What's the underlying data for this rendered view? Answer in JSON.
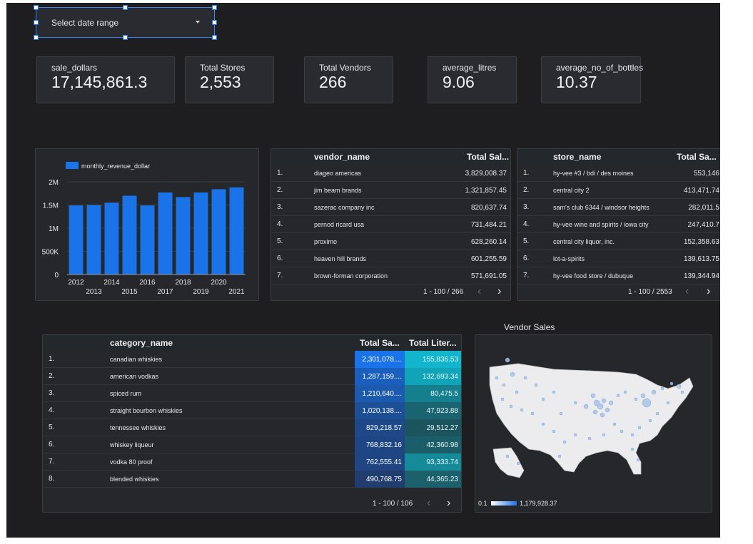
{
  "date_range": {
    "label": "Select date range"
  },
  "scorecards": [
    {
      "label": "sale_dollars",
      "value": "17,145,861.3"
    },
    {
      "label": "Total Stores",
      "value": "2,553"
    },
    {
      "label": "Total Vendors",
      "value": "266"
    },
    {
      "label": "average_litres",
      "value": "9.06"
    },
    {
      "label": "average_no_of_bottles",
      "value": "10.37"
    }
  ],
  "chart_data": {
    "type": "bar",
    "legend": "monthly_revenue_dollar",
    "categories": [
      "2012",
      "2013",
      "2014",
      "2015",
      "2016",
      "2017",
      "2018",
      "2019",
      "2020",
      "2021"
    ],
    "values": [
      1490000,
      1500000,
      1550000,
      1700000,
      1490000,
      1770000,
      1670000,
      1770000,
      1840000,
      1880000
    ],
    "ylim": [
      0,
      2000000
    ],
    "yticks": [
      "0",
      "500K",
      "1M",
      "1.5M",
      "2M"
    ],
    "bar_color": "#1a73e8"
  },
  "vendor_table": {
    "col_name": "vendor_name",
    "col_value": "Total Sal...",
    "rows": [
      {
        "idx": "1.",
        "name": "diageo americas",
        "value": "3,829,008.37"
      },
      {
        "idx": "2.",
        "name": "jim beam brands",
        "value": "1,321,857.45"
      },
      {
        "idx": "3.",
        "name": "sazerac company inc",
        "value": "820,637.74"
      },
      {
        "idx": "4.",
        "name": "pernod ricard usa",
        "value": "731,484.21"
      },
      {
        "idx": "5.",
        "name": "proximo",
        "value": "628,260.14"
      },
      {
        "idx": "6.",
        "name": "heaven hill brands",
        "value": "601,255.59"
      },
      {
        "idx": "7.",
        "name": "brown-forman corporation",
        "value": "571,691.05"
      }
    ],
    "pager": "1 - 100 / 266"
  },
  "store_table": {
    "col_name": "store_name",
    "col_value": "Total Sa...",
    "rows": [
      {
        "idx": "1.",
        "name": "hy-vee #3 / bdi / des moines",
        "value": "553,146"
      },
      {
        "idx": "2.",
        "name": "central city 2",
        "value": "413,471.74"
      },
      {
        "idx": "3.",
        "name": "sam's club 6344 / windsor heights",
        "value": "282,011.5"
      },
      {
        "idx": "4.",
        "name": "hy-vee wine and spirits / iowa city",
        "value": "247,410.7"
      },
      {
        "idx": "5.",
        "name": "central city liquor, inc.",
        "value": "152,358.63"
      },
      {
        "idx": "6.",
        "name": "lot-a-spirits",
        "value": "139,613.75"
      },
      {
        "idx": "7.",
        "name": "hy-vee food store / dubuque",
        "value": "139,344.94"
      }
    ],
    "pager": "1 - 100 / 2553"
  },
  "category_table": {
    "col_name": "category_name",
    "col_sales": "Total Sa...",
    "col_liters": "Total Liter...",
    "rows": [
      {
        "idx": "1.",
        "name": "canadian whiskies",
        "sales": "2,301,078....",
        "liters": "155,836.53",
        "sales_color": "#1a73e8",
        "liters_color": "#12b5cb"
      },
      {
        "idx": "2.",
        "name": "american vodkas",
        "sales": "1,287,159....",
        "liters": "132,693.34",
        "sales_color": "#1a5fbd",
        "liters_color": "#11a4b8"
      },
      {
        "idx": "3.",
        "name": "spiced rum",
        "sales": "1,210,640....",
        "liters": "80,475.5",
        "sales_color": "#1c5aaf",
        "liters_color": "#167f8d"
      },
      {
        "idx": "4.",
        "name": "straight bourbon whiskies",
        "sales": "1,020,138....",
        "liters": "47,923.88",
        "sales_color": "#1d4f97",
        "liters_color": "#1a6370"
      },
      {
        "idx": "5.",
        "name": "tennessee whiskies",
        "sales": "829,218.57",
        "liters": "29,512.27",
        "sales_color": "#1f4888",
        "liters_color": "#1c545e"
      },
      {
        "idx": "6.",
        "name": "whiskey liqueur",
        "sales": "768,832.16",
        "liters": "42,360.98",
        "sales_color": "#1f4684",
        "liters_color": "#1b5e69"
      },
      {
        "idx": "7.",
        "name": "vodka 80 proof",
        "sales": "762,555.41",
        "liters": "93,333.74",
        "sales_color": "#1f4683",
        "liters_color": "#158a99"
      },
      {
        "idx": "8.",
        "name": "blended whiskies",
        "sales": "490,768.75",
        "liters": "44,365.23",
        "sales_color": "#213d6e",
        "liters_color": "#1b606b"
      }
    ],
    "pager": "1 - 100 / 106"
  },
  "map": {
    "title": "Vendor Sales",
    "legend_min": "0.1",
    "legend_max": "1,179,928.37"
  }
}
